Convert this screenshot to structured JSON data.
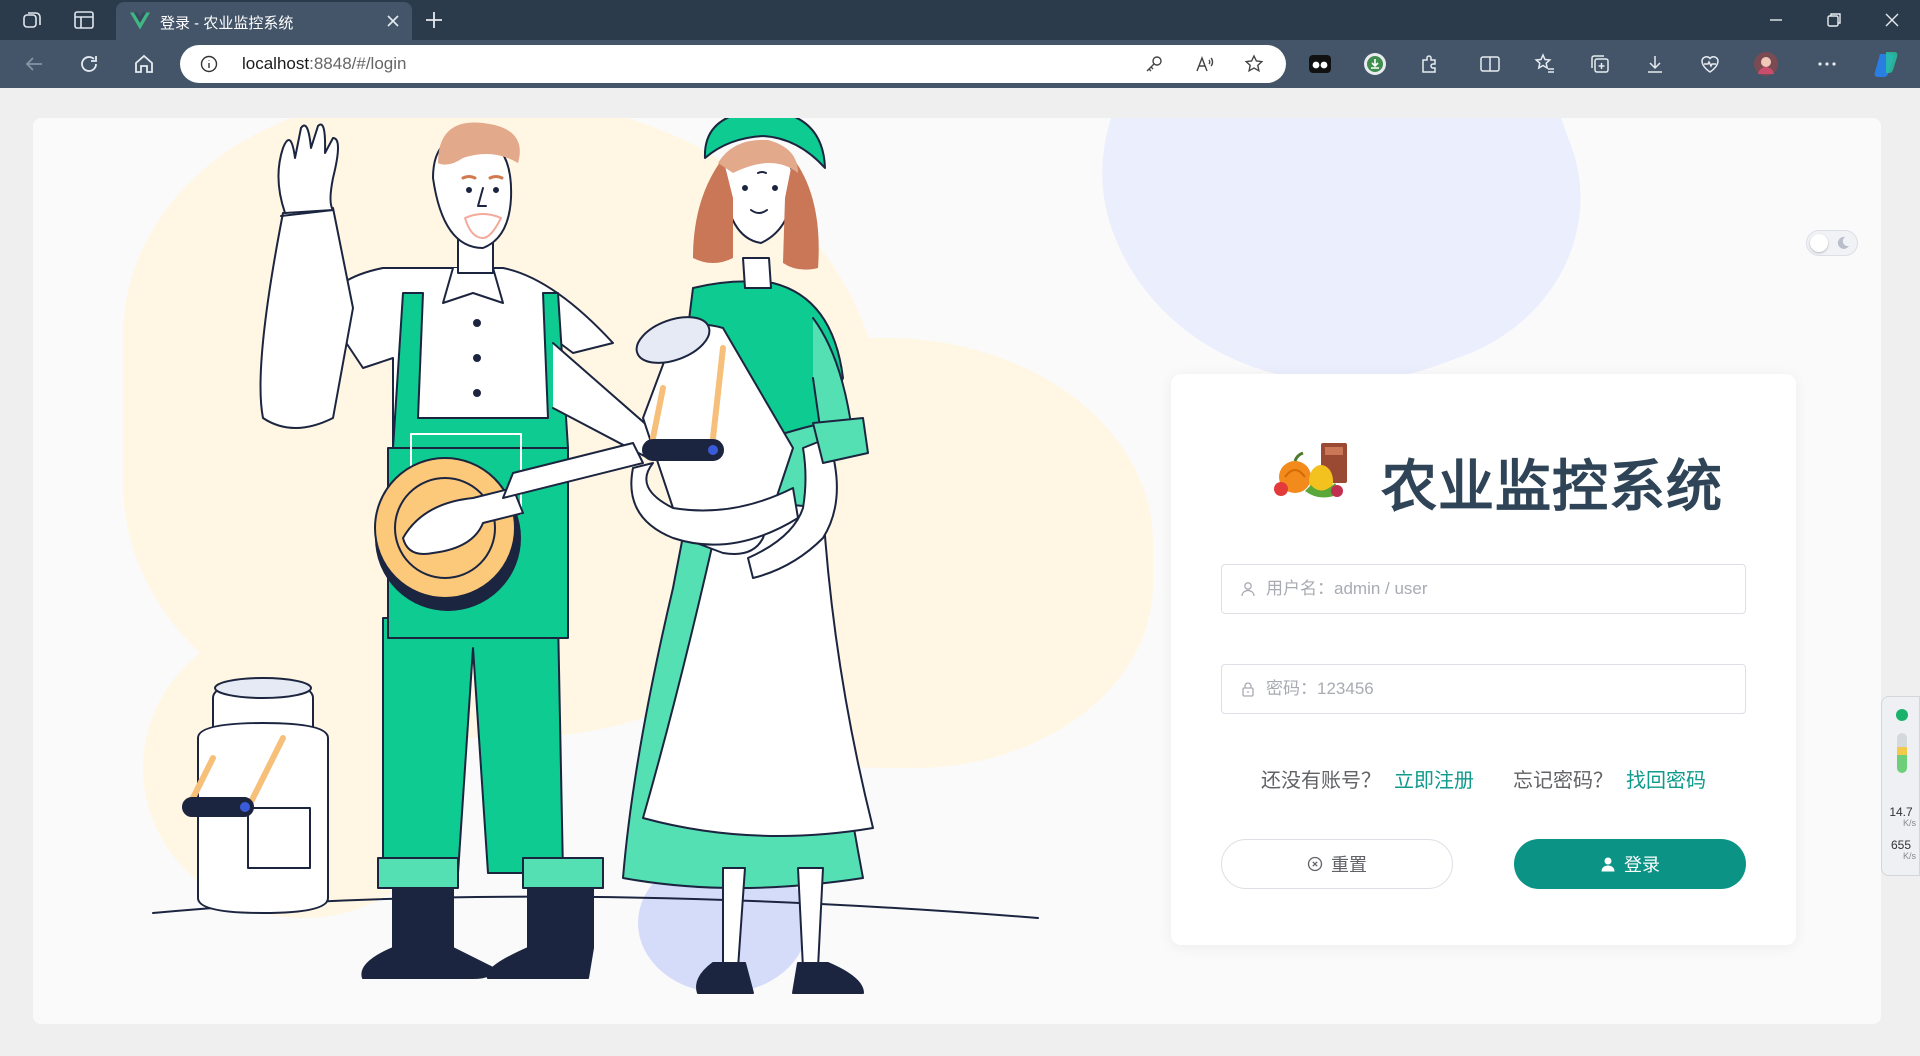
{
  "browser": {
    "tab_title": "登录 - 农业监控系统",
    "url_host": "localhost",
    "url_rest": ":8848/#/login"
  },
  "login": {
    "system_title": "农业监控系统",
    "username_placeholder": "用户名：admin / user",
    "password_placeholder": "密码：123456",
    "no_account_text": "还没有账号？",
    "register_link": "立即注册",
    "forgot_text": "忘记密码？",
    "recover_link": "找回密码",
    "reset_button": "重置",
    "login_button": "登录"
  },
  "side_widget": {
    "upload_speed": "14.7",
    "upload_unit": "K/s",
    "download_speed": "655",
    "download_unit": "K/s"
  },
  "colors": {
    "primary": "#0b9385",
    "link": "#0f9a8c",
    "title": "#2f4457",
    "chrome": "#2c3b4b"
  }
}
